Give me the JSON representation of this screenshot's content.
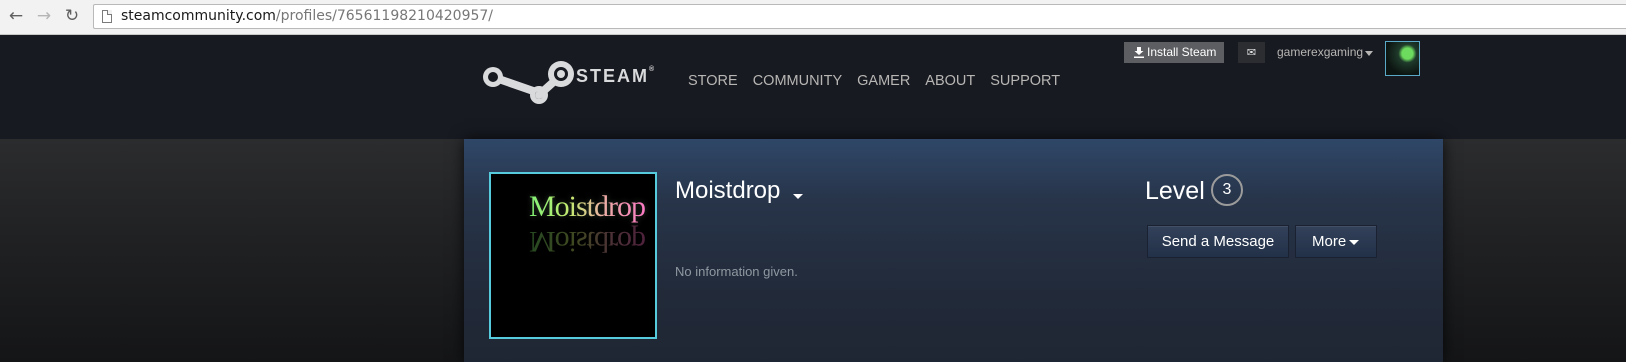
{
  "browser": {
    "back_icon": "arrow-left-icon",
    "forward_icon": "arrow-right-icon",
    "reload_icon": "reload-icon",
    "url_host": "steamcommunity.com",
    "url_path": "/profiles/76561198210420957/"
  },
  "steam_header": {
    "logo_text": "STEAM",
    "logo_mark": "®",
    "menu": [
      {
        "label": "STORE"
      },
      {
        "label": "COMMUNITY"
      },
      {
        "label": "GAMER"
      },
      {
        "label": "ABOUT"
      },
      {
        "label": "SUPPORT"
      }
    ],
    "install_label": "Install Steam",
    "account_name": "gamerexgaming",
    "colors": {
      "header_bg": "#171a21",
      "menu_text": "#b8b6b4"
    }
  },
  "profile": {
    "avatar_text": "Moistdrop",
    "persona_name": "Moistdrop",
    "summary": "No information given.",
    "level_label": "Level",
    "level_value": "3",
    "send_message_label": "Send a Message",
    "more_label": "More",
    "colors": {
      "avatar_border": "#57cbde",
      "panel_top": "#2f4768",
      "summary_text": "#8f98a0"
    }
  }
}
